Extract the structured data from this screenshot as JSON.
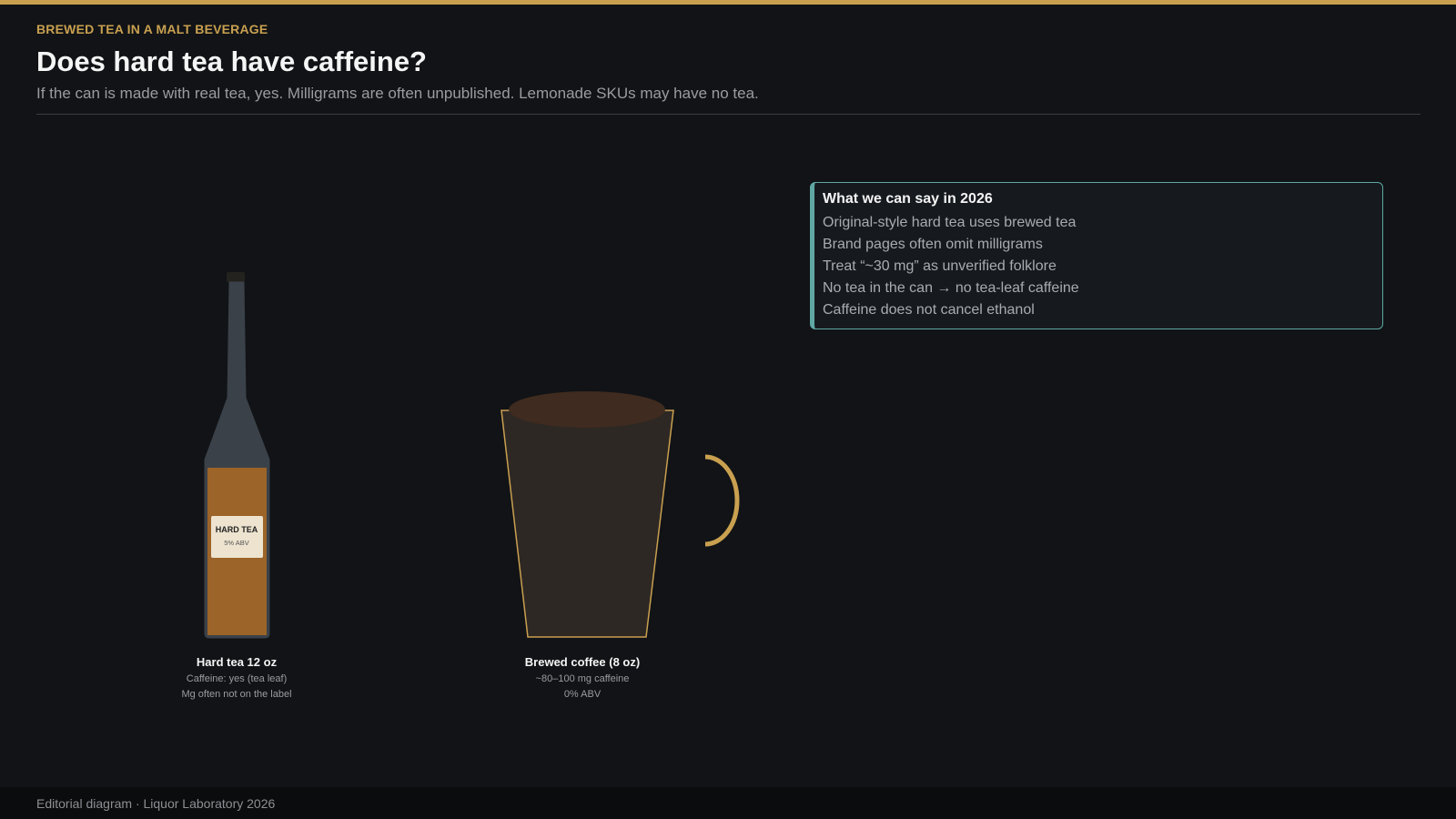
{
  "header": {
    "eyebrow": "BREWED TEA IN A MALT BEVERAGE",
    "title": "Does hard tea have caffeine?",
    "subtitle": "If the can is made with real tea, yes. Milligrams are often unpublished. Lemonade SKUs may have no tea."
  },
  "bottle": {
    "label_title": "HARD TEA",
    "label_sub": "5% ABV",
    "caption_title": "Hard tea 12 oz",
    "caption_lines": [
      "Caffeine: yes (tea leaf)",
      "Mg often not on the label"
    ]
  },
  "coffee": {
    "caption_title": "Brewed coffee (8 oz)",
    "caption_lines": [
      "~80–100 mg caffeine",
      "0% ABV"
    ]
  },
  "note": {
    "title": "What we can say in 2026",
    "items": [
      "Original-style hard tea uses brewed tea",
      "Brand pages often omit milligrams",
      "Treat “~30 mg” as unverified folklore",
      "No tea in the can → no tea-leaf caffeine",
      "Caffeine does not cancel ethanol"
    ]
  },
  "footer": {
    "text": "Editorial diagram · Liquor Laboratory 2026"
  },
  "colors": {
    "accent_gold": "#c9a050",
    "accent_teal": "#5fa8a4",
    "bottle_glass": "#3b4149",
    "tea_liquid": "#9c6428",
    "coffee_cup": "#2e2824",
    "coffee_surface": "#3f2b1f"
  }
}
